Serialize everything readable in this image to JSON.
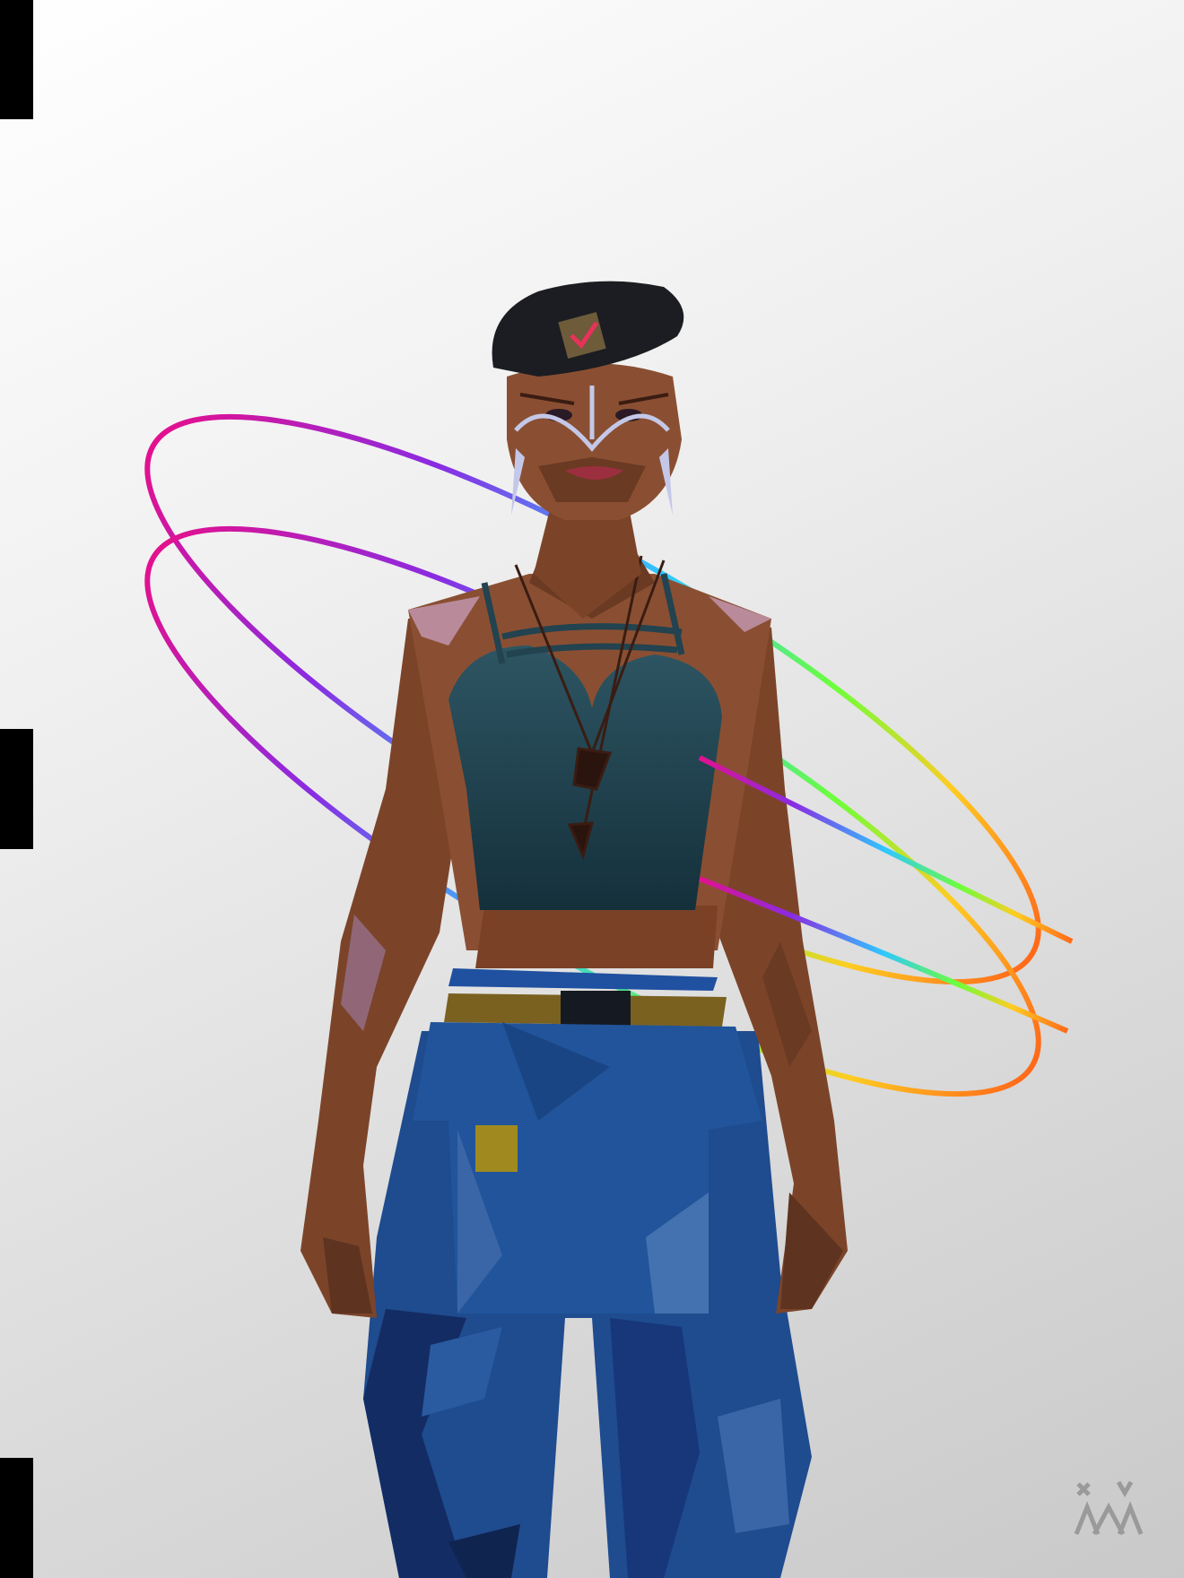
{
  "artwork": {
    "subject": "low-poly woman",
    "colors": {
      "background_light": "#ffffff",
      "background_dark": "#c9c9c9",
      "skin": "#8a4f32",
      "skin_shadow": "#5f331d",
      "skin_highlight": "#b98a9a",
      "beret": "#1b1d22",
      "badge": "#6d5b3a",
      "badge_check": "#e8325a",
      "top": "#1d3d4a",
      "jeans": "#1f4b8f",
      "jeans_dark": "#132c63",
      "belt": "#7a6120",
      "pocket_patch": "#a08a1f",
      "ring_colors": [
        "#e2118f",
        "#8a2be2",
        "#2ec8ff",
        "#6cff3a",
        "#ffcc22",
        "#ff6a1a"
      ],
      "edge_marks": "#000000",
      "logo": "#9a9a9a"
    },
    "icons": [
      "beret-badge-check-icon",
      "watermark-logo-icon"
    ]
  }
}
